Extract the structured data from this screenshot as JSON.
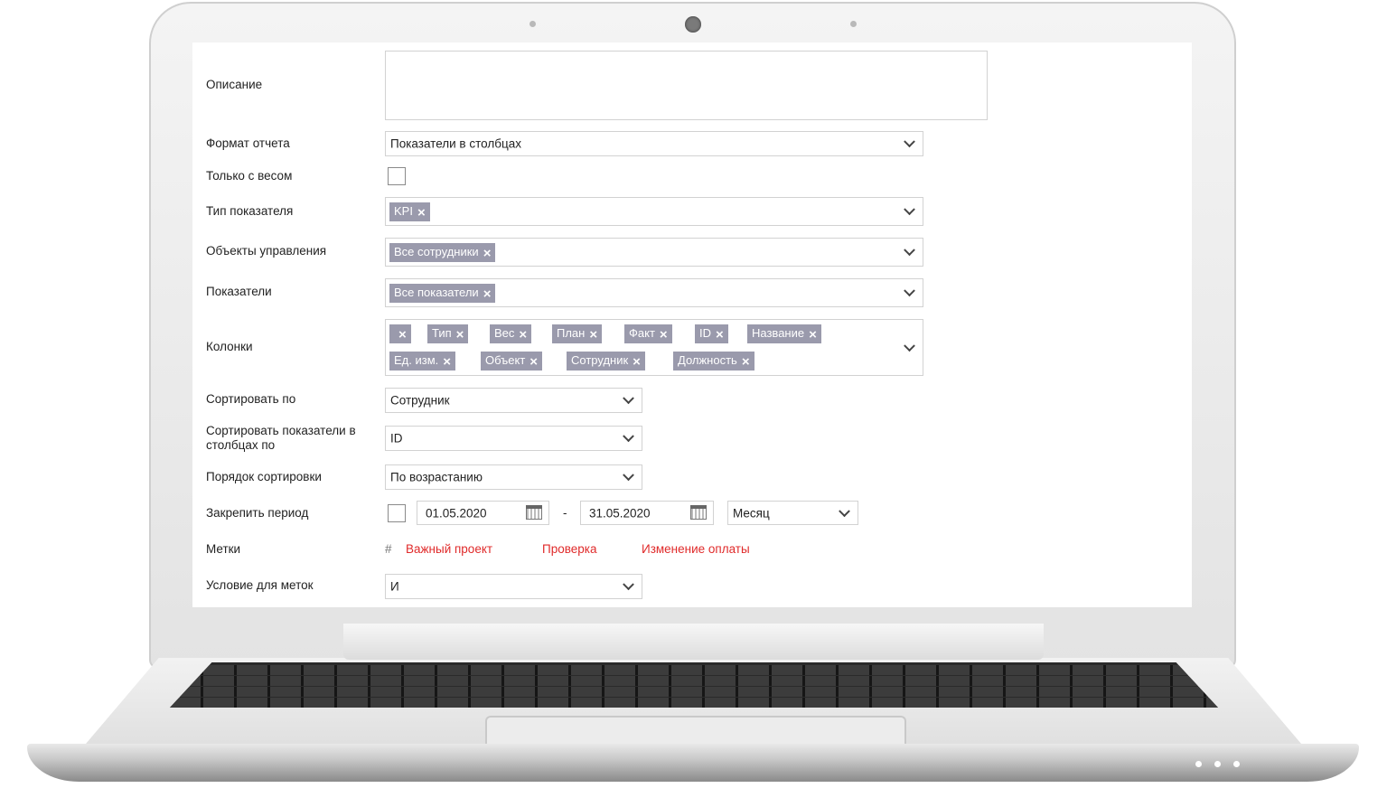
{
  "form": {
    "description_label": "Описание",
    "description_value": "",
    "report_format": {
      "label": "Формат отчета",
      "value": "Показатели в столбцах"
    },
    "weight_only": {
      "label": "Только с весом",
      "checked": false
    },
    "indicator_type": {
      "label": "Тип показателя",
      "tags": [
        "KPI"
      ]
    },
    "control_objects": {
      "label": "Объекты управления",
      "tags": [
        "Все сотрудники"
      ]
    },
    "indicators": {
      "label": "Показатели",
      "tags": [
        "Все показатели"
      ]
    },
    "columns": {
      "label": "Колонки",
      "tags": [
        "",
        "Тип",
        "Вес",
        "План",
        "Факт",
        "ID",
        "Название",
        "Ед. изм.",
        "Объект",
        "Сотрудник",
        "Должность"
      ]
    },
    "sort_by": {
      "label": "Сортировать по",
      "value": "Сотрудник"
    },
    "sort_indicators_in_columns": {
      "label": "Сортировать показатели в столбцах по",
      "value": "ID"
    },
    "sort_order": {
      "label": "Порядок сортировки",
      "value": "По возрастанию"
    },
    "fix_period": {
      "label": "Закрепить период",
      "checked": false,
      "date_from": "01.05.2020",
      "separator": "-",
      "date_to": "31.05.2020",
      "period": "Месяц"
    },
    "marks": {
      "label": "Метки",
      "items": [
        "Важный проект",
        "Проверка",
        "Изменение оплаты"
      ],
      "color": "#e02a2a",
      "icon": "hash-icon"
    },
    "marks_condition": {
      "label": "Условие для меток",
      "value": "И"
    }
  },
  "colors": {
    "tag_bg": "#9a9aac",
    "field_border": "#d2d2d2"
  }
}
